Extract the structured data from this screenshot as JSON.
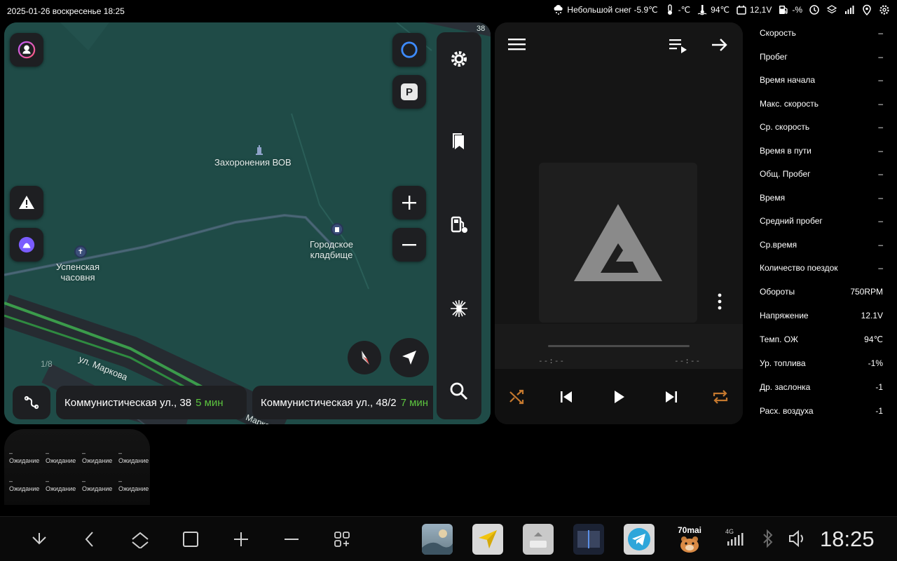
{
  "statusbar": {
    "datetime": "2025-01-26 воскресенье 18:25",
    "weather": "Небольшой снег -5.9℃",
    "outside_temp": "-℃",
    "engine_temp": "94℃",
    "voltage": "12,1V",
    "fuel": "-%"
  },
  "map": {
    "labels": {
      "burials": "Захоронения ВОВ",
      "cemetery": "Городское\nкладбище",
      "chapel": "Успенская\nчасовня",
      "street": "ул. Маркова",
      "street2": "Марко",
      "road_num": "38"
    },
    "pager": "1/8",
    "parking_label": "P",
    "routes": [
      {
        "address": "Коммунистическая ул., 38",
        "time": "5 мин"
      },
      {
        "address": "Коммунистическая ул., 48/2",
        "time": "7 мин"
      }
    ]
  },
  "player": {
    "elapsed": "--:--",
    "total": "--:--"
  },
  "stats": [
    {
      "label": "Скорость",
      "value": "–"
    },
    {
      "label": "Пробег",
      "value": "–"
    },
    {
      "label": "Время начала",
      "value": "–"
    },
    {
      "label": "Макс. скорость",
      "value": "–"
    },
    {
      "label": "Ср. скорость",
      "value": "–"
    },
    {
      "label": "Время в пути",
      "value": "–"
    },
    {
      "label": "Общ. Пробег",
      "value": "–"
    },
    {
      "label": "Время",
      "value": "–"
    },
    {
      "label": "Средний пробег",
      "value": "–"
    },
    {
      "label": "Ср.время",
      "value": "–"
    },
    {
      "label": "Количество поездок",
      "value": "–"
    },
    {
      "label": "Обороты",
      "value": "750RPM"
    },
    {
      "label": "Напряжение",
      "value": "12.1V"
    },
    {
      "label": "Темп. ОЖ",
      "value": "94℃"
    },
    {
      "label": "Ур. топлива",
      "value": "-1%"
    },
    {
      "label": "Др. заслонка",
      "value": "-1"
    },
    {
      "label": "Расх. воздуха",
      "value": "-1"
    }
  ],
  "widget": {
    "dash": "–",
    "status": "Ожидание"
  },
  "navbar": {
    "clock": "18:25",
    "network": "4G",
    "bear_app_label": "70mai"
  },
  "colors": {
    "map_bg": "#1f4b47",
    "route_time": "#5cc43f",
    "player_accent": "#c4782e"
  }
}
